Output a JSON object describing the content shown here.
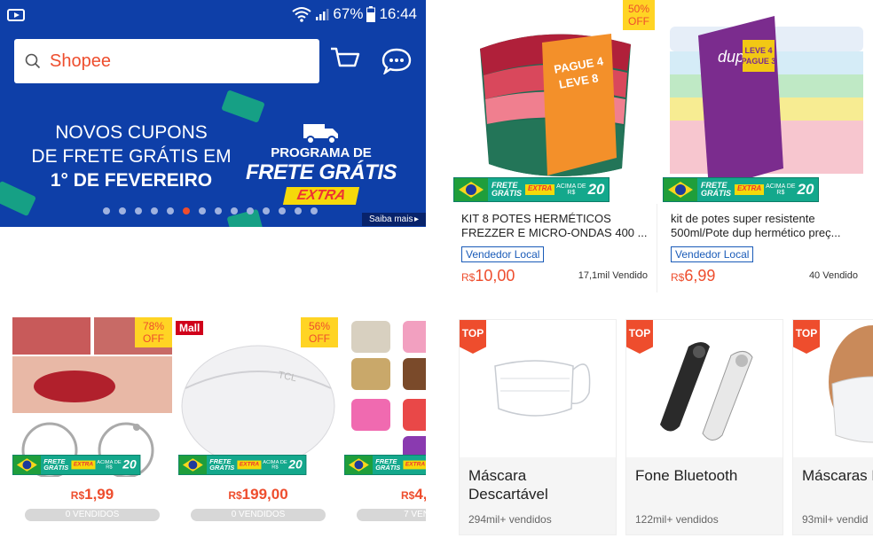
{
  "statusbar": {
    "battery": "67%",
    "time": "16:44"
  },
  "search": {
    "placeholder": "Shopee"
  },
  "banner": {
    "line1": "NOVOS CUPONS",
    "line2": "DE FRETE GRÁTIS EM",
    "line3": "1° DE FEVEREIRO",
    "program_line1": "PROGRAMA DE",
    "program_line2": "FRETE GRÁTIS",
    "program_line3": "EXTRA",
    "saiba_mais": "Saiba mais",
    "dots_count": 14,
    "active_dot": 5
  },
  "badge": {
    "frete1": "FRETE",
    "frete2": "GRÁTIS",
    "extra": "EXTRA",
    "acima": "ACIMA DE",
    "rs": "R$",
    "amount": "20"
  },
  "products_top": [
    {
      "off_pct": "50%",
      "off": "OFF",
      "title": "KIT 8  POTES HERMÉTICOS FREZZER E MICRO-ONDAS 400 ...",
      "local": "Vendedor Local",
      "currency": "R$",
      "price": "10,00",
      "sold": "17,1mil Vendido",
      "box_text1": "PAGUE 4",
      "box_text2": "LEVE 8"
    },
    {
      "title": "kit de potes super resistente 500ml/Pote dup hermético preç...",
      "local": "Vendedor Local",
      "currency": "R$",
      "price": "6,99",
      "sold": "40 Vendido",
      "box_text1": "LEVE 4",
      "box_text2": "PAGUE 3",
      "box_brand": "dup"
    }
  ],
  "products_grid": [
    {
      "off_pct": "78%",
      "off": "OFF",
      "currency": "R$",
      "price": "1,99",
      "sold": "0 VENDIDOS"
    },
    {
      "mall": "Mall",
      "off_pct": "56%",
      "off": "OFF",
      "currency": "R$",
      "price": "199,00",
      "sold": "0 VENDIDOS",
      "brand": "TCL"
    },
    {
      "currency": "R$",
      "price": "4,",
      "sold": "7 VEN"
    }
  ],
  "top_products": [
    {
      "tag": "TOP",
      "title": "Máscara Descartável",
      "sold": "294mil+ vendidos"
    },
    {
      "tag": "TOP",
      "title": "Fone Bluetooth",
      "sold": "122mil+ vendidos"
    },
    {
      "tag": "TOP",
      "title": "Máscaras Descartáv",
      "sold": "93mil+ vendid"
    }
  ]
}
